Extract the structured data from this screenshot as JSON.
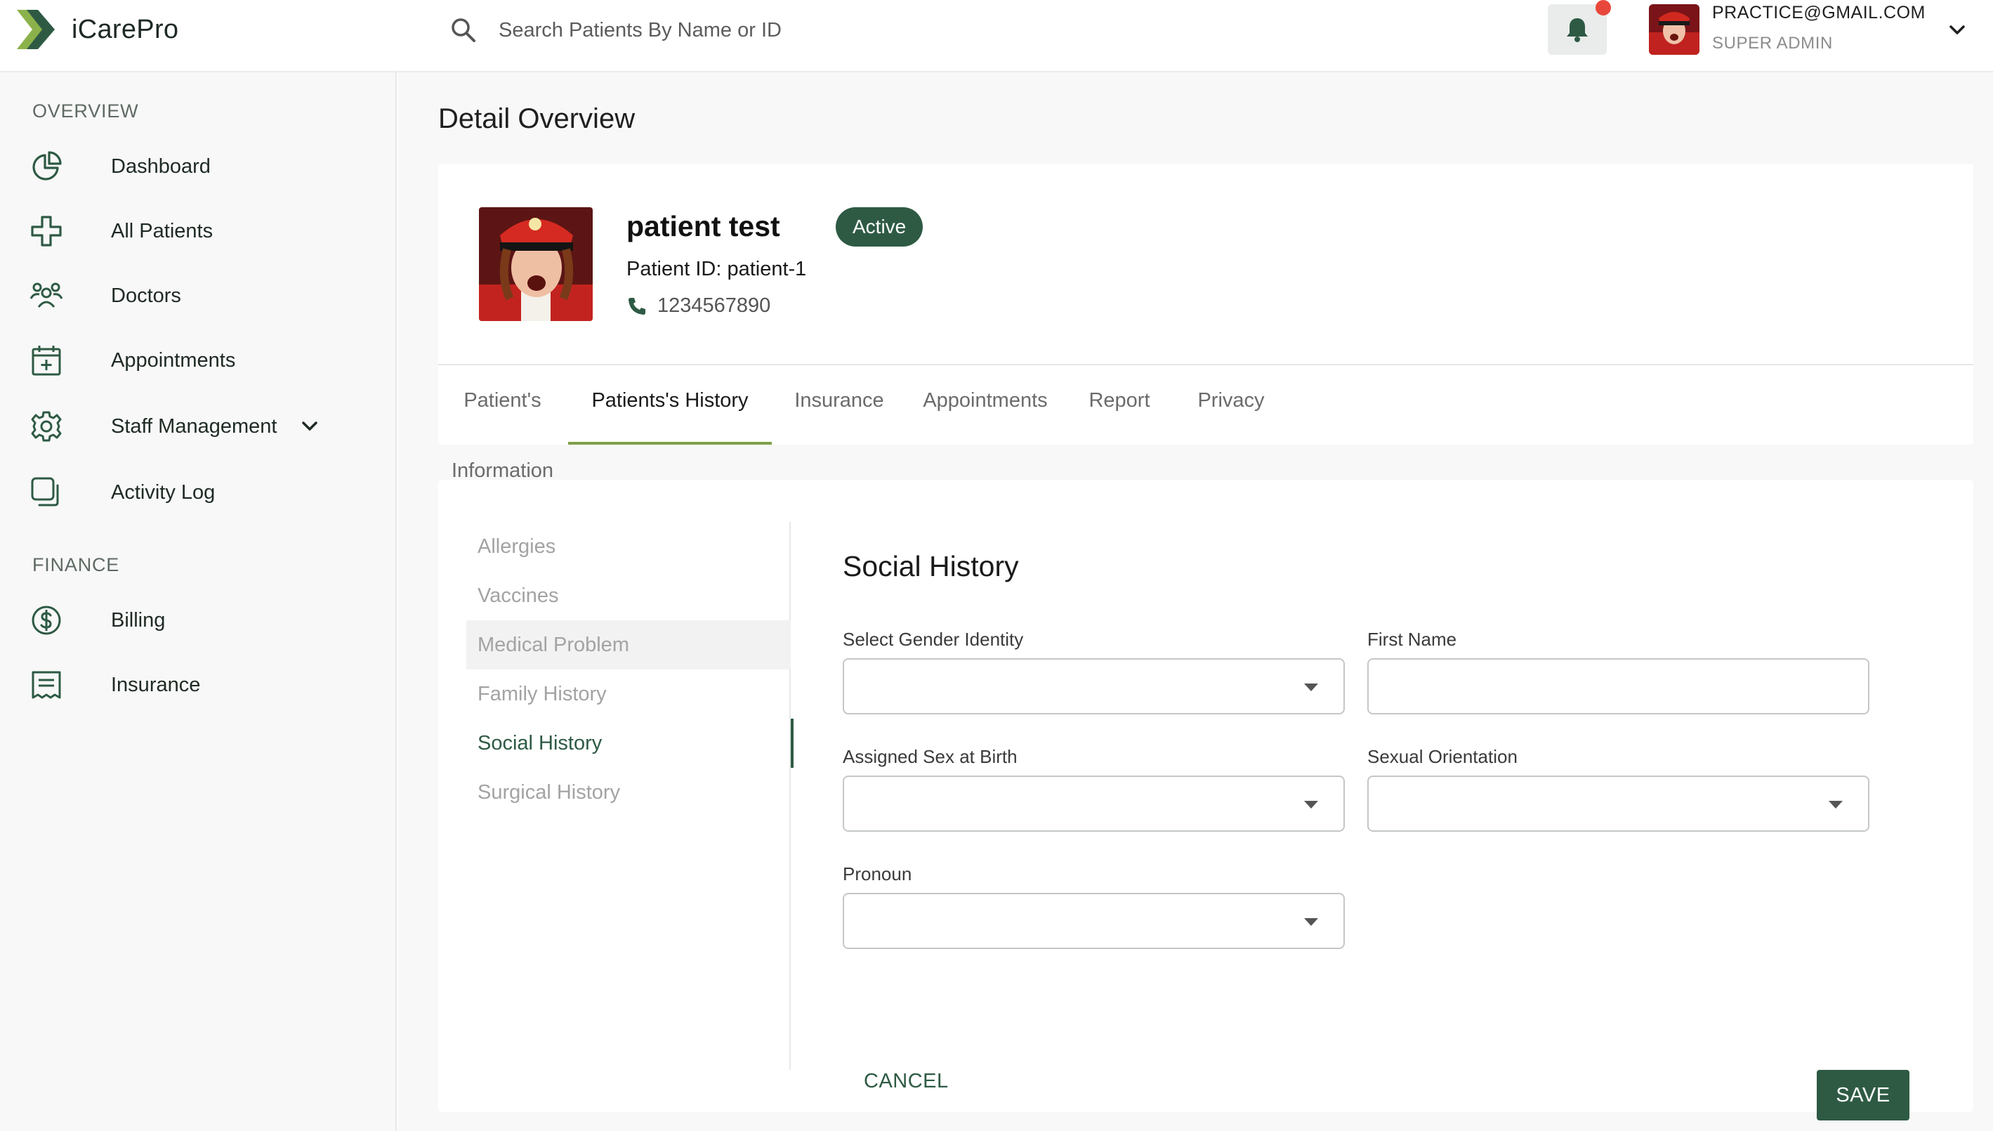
{
  "app": {
    "name": "iCarePro",
    "brand_color": "#2e5a44",
    "accent_color": "#7fa04a"
  },
  "header": {
    "search_placeholder": "Search Patients By Name or ID",
    "user_email": "PRACTICE@GMAIL.COM",
    "user_role": "SUPER ADMIN"
  },
  "sidebar": {
    "overview_label": "OVERVIEW",
    "overview_items": [
      {
        "label": "Dashboard",
        "icon": "pie-chart-icon"
      },
      {
        "label": "All Patients",
        "icon": "medical-cross-icon"
      },
      {
        "label": "Doctors",
        "icon": "users-group-icon"
      },
      {
        "label": "Appointments",
        "icon": "calendar-plus-icon"
      },
      {
        "label": "Staff Management",
        "icon": "gear-icon"
      },
      {
        "label": "Activity Log",
        "icon": "copy-icon"
      }
    ],
    "finance_label": "FINANCE",
    "finance_items": [
      {
        "label": "Billing",
        "icon": "dollar-circle-icon"
      },
      {
        "label": "Insurance",
        "icon": "receipt-icon"
      }
    ]
  },
  "page": {
    "title": "Detail Overview"
  },
  "patient": {
    "name": "patient test",
    "status": "Active",
    "id_text": "Patient ID: patient-1",
    "phone": "1234567890"
  },
  "tabs": [
    {
      "label": "Patient's Information"
    },
    {
      "label": "Patients's History"
    },
    {
      "label": "Insurance"
    },
    {
      "label": "Appointments"
    },
    {
      "label": "Report"
    },
    {
      "label": "Privacy"
    }
  ],
  "history_nav": [
    {
      "label": "Allergies"
    },
    {
      "label": "Vaccines"
    },
    {
      "label": "Medical Problem"
    },
    {
      "label": "Family History"
    },
    {
      "label": "Social History"
    },
    {
      "label": "Surgical History"
    }
  ],
  "form": {
    "title": "Social History",
    "gender_identity_label": "Select Gender Identity",
    "first_name_label": "First Name",
    "sex_at_birth_label": "Assigned Sex at Birth",
    "sexual_orientation_label": "Sexual Orientation",
    "pronoun_label": "Pronoun",
    "cancel_label": "CANCEL",
    "save_label": "SAVE"
  }
}
